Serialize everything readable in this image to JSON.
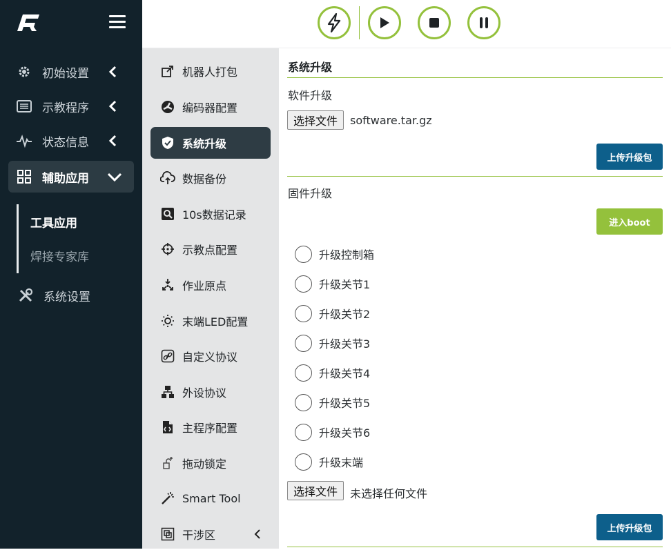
{
  "toolbar": {
    "icons": [
      "lightning-icon",
      "play-icon",
      "stop-icon",
      "pause-icon"
    ],
    "accent": "#94c13c"
  },
  "sidebar": {
    "items": [
      {
        "label": "初始设置",
        "icon": "gear-icon"
      },
      {
        "label": "示教程序",
        "icon": "list-icon"
      },
      {
        "label": "状态信息",
        "icon": "pulse-icon"
      },
      {
        "label": "辅助应用",
        "icon": "grid-icon"
      },
      {
        "label": "系统设置",
        "icon": "tools-icon"
      }
    ],
    "subitems": [
      {
        "label": "工具应用"
      },
      {
        "label": "焊接专家库"
      }
    ]
  },
  "menu": {
    "items": [
      {
        "label": "机器人打包"
      },
      {
        "label": "编码器配置"
      },
      {
        "label": "系统升级"
      },
      {
        "label": "数据备份"
      },
      {
        "label": "10s数据记录"
      },
      {
        "label": "示教点配置"
      },
      {
        "label": "作业原点"
      },
      {
        "label": "末端LED配置"
      },
      {
        "label": "自定义协议"
      },
      {
        "label": "外设协议"
      },
      {
        "label": "主程序配置"
      },
      {
        "label": "拖动锁定"
      },
      {
        "label": "Smart Tool"
      },
      {
        "label": "干涉区"
      }
    ]
  },
  "content": {
    "title": "系统升级",
    "software": {
      "label": "软件升级",
      "choose_file": "选择文件",
      "file_name": "software.tar.gz",
      "upload": "上传升级包"
    },
    "firmware": {
      "label": "固件升级",
      "boot": "进入boot",
      "options": [
        "升级控制箱",
        "升级关节1",
        "升级关节2",
        "升级关节3",
        "升级关节4",
        "升级关节5",
        "升级关节6",
        "升级末端"
      ],
      "choose_file": "选择文件",
      "file_name": "未选择任何文件",
      "upload": "上传升级包"
    }
  },
  "colors": {
    "sidebar_bg": "#12222b",
    "menu_bg": "#e4e5e6",
    "active_bg": "#2e3c44",
    "primary_blue": "#0d5f8b",
    "accent_green": "#94c13c"
  }
}
